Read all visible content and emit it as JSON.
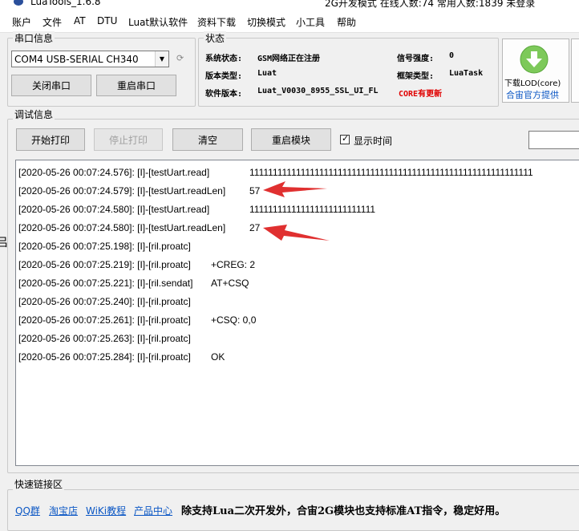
{
  "window": {
    "title": "LuaTools_1.6.8",
    "status_text": "2G开发模式 在线人数:74 常用人数:1839 未登录"
  },
  "menu": [
    "账户",
    "文件",
    "AT",
    "DTU",
    "Luat默认软件",
    "资料下载",
    "切换模式",
    "小工具",
    "帮助"
  ],
  "serial": {
    "group_label": "串口信息",
    "port_value": "COM4 USB-SERIAL CH340",
    "close_button": "关闭串口",
    "reopen_button": "重启串口"
  },
  "status": {
    "group_label": "状态",
    "system_label": "系统状态:",
    "system_value": "GSM网络正在注册",
    "signal_label": "信号强度:",
    "signal_value": "0",
    "version_type_label": "版本类型:",
    "version_type_value": "Luat",
    "framework_label": "框架类型:",
    "framework_value": "LuaTask",
    "software_label": "软件版本:",
    "software_value": "Luat_V0030_8955_SSL_UI_FL",
    "software_update": "CORE有更新"
  },
  "download": {
    "label": "下载LOD(core)",
    "link": "合宙官方提供",
    "icon": "download-arrow-icon",
    "icon_color": "#7dc95a"
  },
  "debug": {
    "group_label": "调试信息",
    "start_print": "开始打印",
    "stop_print": "停止打印",
    "clear": "清空",
    "restart_module": "重启模块",
    "show_time_label": "显示时间",
    "show_time_checked": true
  },
  "log": [
    {
      "ts": "[2020-05-26 00:07:24.576]: [I]-[testUart.read]",
      "msg": "1111111111111111111111111111111111111111111111111111111111111"
    },
    {
      "ts": "[2020-05-26 00:07:24.579]: [I]-[testUart.readLen]",
      "msg": "57"
    },
    {
      "ts": "[2020-05-26 00:07:24.580]: [I]-[testUart.read]",
      "msg": "111111111111111111111111111"
    },
    {
      "ts": "[2020-05-26 00:07:24.580]: [I]-[testUart.readLen]",
      "msg": "27"
    },
    {
      "ts": "[2020-05-26 00:07:25.198]: [I]-[ril.proatc]",
      "msg": ""
    },
    {
      "ts": "[2020-05-26 00:07:25.219]: [I]-[ril.proatc]",
      "msg": "+CREG: 2"
    },
    {
      "ts": "[2020-05-26 00:07:25.221]: [I]-[ril.sendat]",
      "msg": "AT+CSQ"
    },
    {
      "ts": "[2020-05-26 00:07:25.240]: [I]-[ril.proatc]",
      "msg": ""
    },
    {
      "ts": "[2020-05-26 00:07:25.261]: [I]-[ril.proatc]",
      "msg": "+CSQ: 0,0"
    },
    {
      "ts": "[2020-05-26 00:07:25.263]: [I]-[ril.proatc]",
      "msg": ""
    },
    {
      "ts": "[2020-05-26 00:07:25.284]: [I]-[ril.proatc]",
      "msg": "OK"
    }
  ],
  "annotation_color": "#e03030",
  "quick_links": {
    "group_label": "快速链接区",
    "links": [
      "QQ群",
      "淘宝店",
      "WiKi教程",
      "产品中心"
    ],
    "note": "除支持Lua二次开发外，合宙2G模块也支持标准AT指令，稳定好用。"
  },
  "side_glyph": "吕"
}
